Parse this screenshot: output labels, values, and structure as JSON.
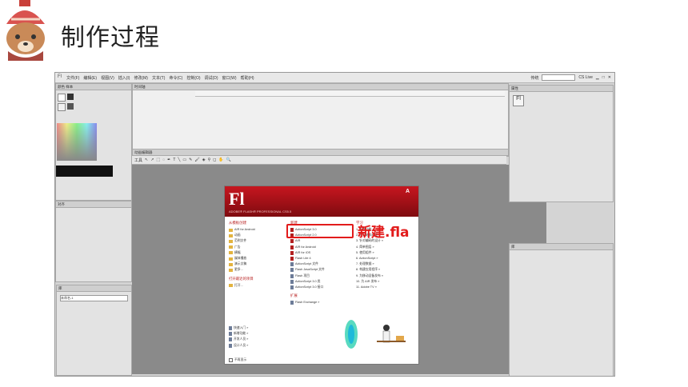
{
  "slide": {
    "title": "制作过程"
  },
  "annotation": {
    "text": "新建.fla"
  },
  "menubar": {
    "logo": "Fl",
    "menus": [
      "文件(F)",
      "编辑(E)",
      "视图(V)",
      "插入(I)",
      "修改(M)",
      "文本(T)",
      "命令(C)",
      "控制(O)",
      "调试(D)",
      "窗口(W)",
      "帮助(H)"
    ],
    "workspace": "传统",
    "cslive": "CS Live"
  },
  "panels": {
    "color_tab": "颜色",
    "swatches_tab": "样本",
    "timeline_tab": "时间轴",
    "properties_tab": "属性",
    "library_tab": "库",
    "align_tab": "对齐",
    "library_header": "未命名-1",
    "compiler_tab": "动画编辑器",
    "tools_label": "工具"
  },
  "welcome": {
    "logo": "Fl",
    "subtitle": "ADOBE® FLASH® PROFESSIONAL CS5.5",
    "adobe": "A",
    "template_head": "从模板创建",
    "templates": [
      "AIR for Android",
      "动画",
      "范例文件",
      "广告",
      "横幅",
      "媒体播放",
      "演示文稿",
      "更多..."
    ],
    "open_head": "打开最近的项目",
    "open_item": "打开...",
    "new_head": "新建",
    "new_items": [
      "ActionScript 3.0",
      "ActionScript 2.0",
      "AIR",
      "AIR for Android",
      "AIR for iOS",
      "Flash Lite 4",
      "ActionScript 文件",
      "Flash JavaScript 文件",
      "Flash 项目",
      "ActionScript 3.0 类",
      "ActionScript 3.0 接口"
    ],
    "extend_head": "扩展",
    "extend_item": "Flash Exchange »",
    "learn_head": "学习",
    "learn_items": [
      "1. 新增功能 »",
      "2. 时间轴和动画 »",
      "3. 针对编码的设计 »",
      "4. 简单图层 »",
      "5. 使用组件 »",
      "6. ActionScript »",
      "7. 处理数据 »",
      "8. 构建应用程序 »",
      "9. 为移动设备发布 »",
      "10. 为 AIR 发布 »",
      "11. Adobe TV »"
    ],
    "bottom_items": [
      "快速入门 »",
      "新增功能 »",
      "开发人员 »",
      "设计人员 »"
    ],
    "dont_show": "不再显示"
  },
  "colors": {
    "flash_red": "#c7161f",
    "annotation_red": "#e21b1b"
  }
}
